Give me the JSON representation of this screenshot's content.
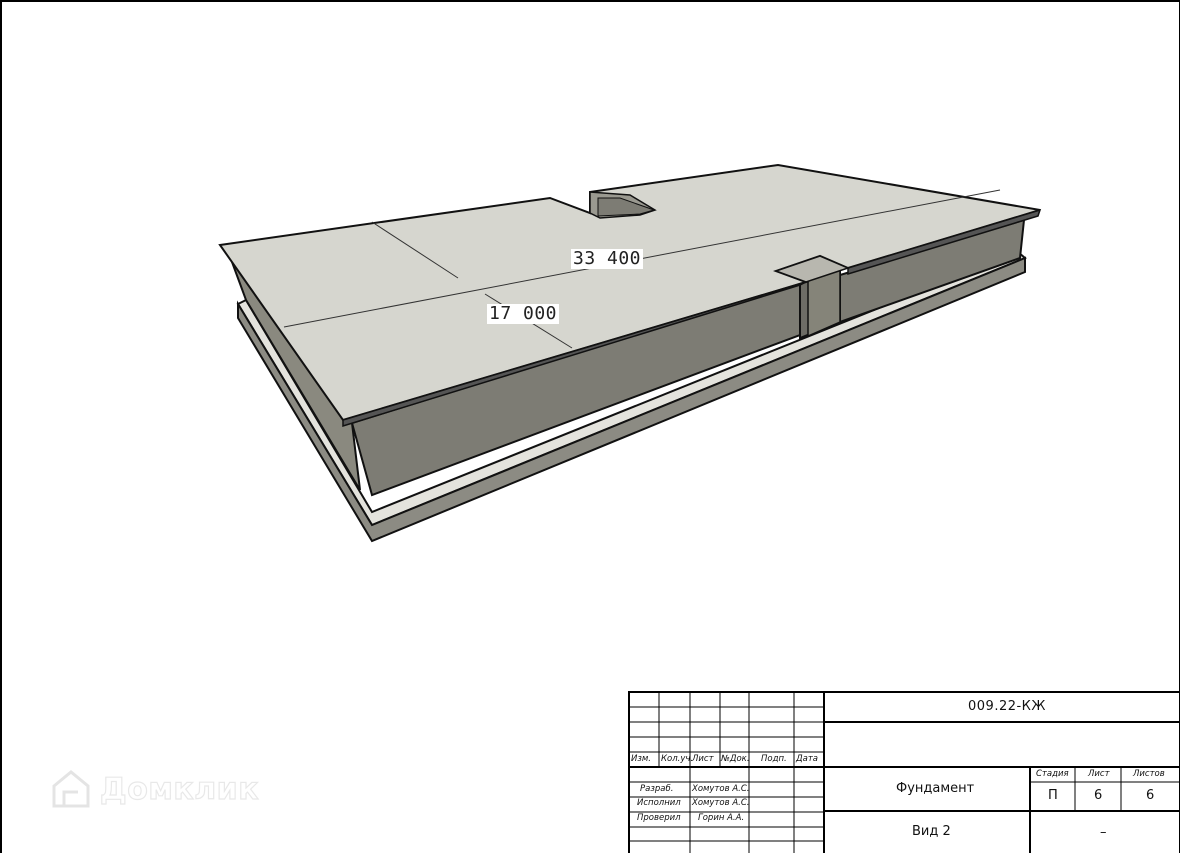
{
  "dimensions": {
    "length_label": "33 400",
    "width_label": "17 000"
  },
  "watermark": {
    "text": "Домклик",
    "icon": "house-logo-icon"
  },
  "title_block": {
    "doc_code": "009.22-КЖ",
    "headers": {
      "izm": "Изм.",
      "kol_uch": "Кол.уч.",
      "list": "Лист",
      "ndok": "№Док.",
      "podp": "Подп.",
      "data": "Дата"
    },
    "roles": [
      {
        "role": "Разраб.",
        "name": "Хомутов А.С."
      },
      {
        "role": "Исполнил",
        "name": "Хомутов А.С."
      },
      {
        "role": "Проверил",
        "name": "Горин А.А."
      }
    ],
    "object_title": "Фундамент",
    "view_title": "Вид 2",
    "stage_header": "Стадия",
    "sheet_header": "Лист",
    "sheets_header": "Листов",
    "stage_value": "П",
    "sheet_value": "6",
    "sheets_value": "6",
    "org_value": "–"
  },
  "colors": {
    "top_face": "#d6d6cf",
    "wall_face": "#7d7c74",
    "plinth_top": "#e4e3dd",
    "plinth_face": "#8c8b83",
    "edge": "#111111"
  }
}
